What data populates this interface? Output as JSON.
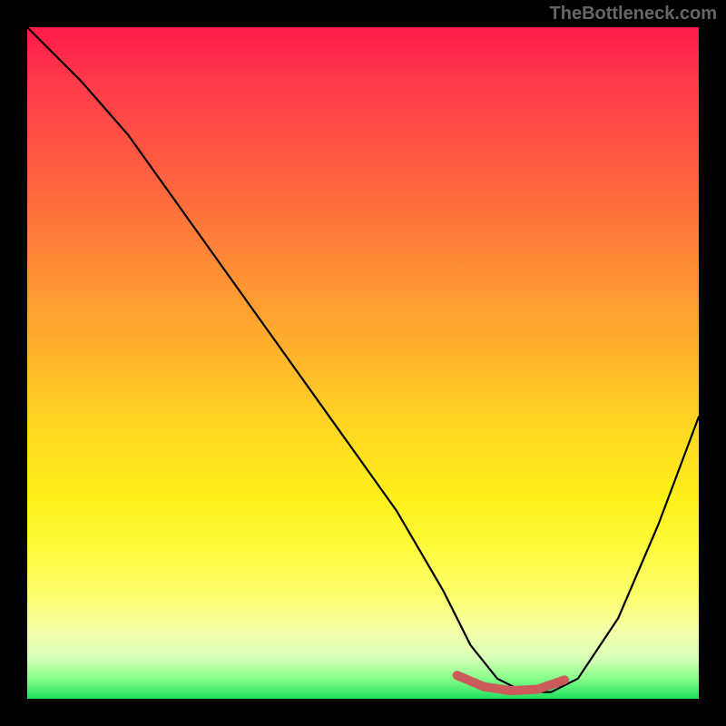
{
  "watermark": "TheBottleneck.com",
  "chart_data": {
    "type": "line",
    "title": "",
    "xlabel": "",
    "ylabel": "",
    "xlim": [
      0,
      100
    ],
    "ylim": [
      0,
      100
    ],
    "grid": false,
    "legend": false,
    "series": [
      {
        "name": "bottleneck-curve",
        "color": "#000000",
        "x": [
          0,
          3,
          8,
          15,
          25,
          35,
          45,
          55,
          62,
          66,
          70,
          74,
          78,
          82,
          88,
          94,
          100
        ],
        "values": [
          100,
          97,
          92,
          84,
          70,
          56,
          42,
          28,
          16,
          8,
          3,
          1,
          1,
          3,
          12,
          26,
          42
        ]
      }
    ],
    "annotations": [
      {
        "name": "bottom-highlight",
        "type": "segment",
        "color": "#cc5a5a",
        "width": 10,
        "x": [
          64,
          68,
          72,
          76,
          80
        ],
        "values": [
          3.5,
          1.8,
          1.2,
          1.4,
          2.8
        ]
      }
    ],
    "background_gradient": {
      "top": "#ff1a4a",
      "mid": "#ffd822",
      "bottom": "#20e060"
    }
  }
}
